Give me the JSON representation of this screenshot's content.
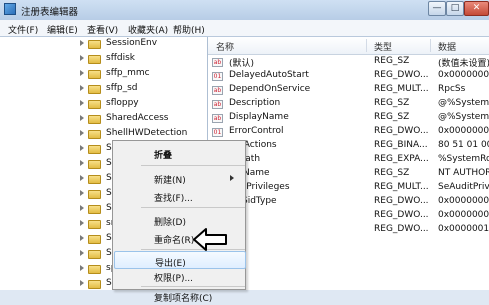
{
  "window": {
    "title": "注册表编辑器",
    "buttons": {
      "minimize": "—",
      "maximize": "□",
      "close": "✕"
    }
  },
  "menu": {
    "items": [
      "文件(F)",
      "编辑(E)",
      "查看(V)",
      "收藏夹(A)",
      "帮助(H)"
    ]
  },
  "tree": {
    "items": [
      {
        "label": "SessionEnv"
      },
      {
        "label": "sffdisk"
      },
      {
        "label": "sffp_mmc"
      },
      {
        "label": "sffp_sd"
      },
      {
        "label": "sfloppy"
      },
      {
        "label": "SharedAccess"
      },
      {
        "label": "ShellHWDetection"
      },
      {
        "label": "SiSRa"
      },
      {
        "label": "SiSRa"
      },
      {
        "label": "Smb"
      },
      {
        "label": "SMS"
      },
      {
        "label": "SMS"
      },
      {
        "label": "snap"
      },
      {
        "label": "SNM"
      },
      {
        "label": "Sogo"
      },
      {
        "label": "spldr"
      },
      {
        "label": "Spoo"
      }
    ]
  },
  "values": {
    "headers": {
      "name": "名称",
      "type": "类型",
      "data": "数据"
    },
    "rows": [
      {
        "name": "(默认)",
        "type": "REG_SZ",
        "data": "(数值未设置)"
      },
      {
        "name": "DelayedAutoStart",
        "type": "REG_DWO...",
        "data": "0x00000001"
      },
      {
        "name": "DependOnService",
        "type": "REG_MULT...",
        "data": "RpcSs"
      },
      {
        "name": "Description",
        "type": "REG_SZ",
        "data": "@%SystemR"
      },
      {
        "name": "DisplayName",
        "type": "REG_SZ",
        "data": "@%SystemR"
      },
      {
        "name": "ErrorControl",
        "type": "REG_DWO...",
        "data": "0x00000001"
      },
      {
        "name": "ureActions",
        "type": "REG_BINA...",
        "data": "80 51 01 00"
      },
      {
        "name": "gePath",
        "type": "REG_EXPA...",
        "data": "%SystemRoo"
      },
      {
        "name": "ectName",
        "type": "REG_SZ",
        "data": "NT AUTHOR"
      },
      {
        "name": "iredPrivileges",
        "type": "REG_MULT...",
        "data": "SeAuditPrivil"
      },
      {
        "name": "iceSidType",
        "type": "REG_DWO...",
        "data": "0x00000001"
      },
      {
        "name": "",
        "type": "REG_DWO...",
        "data": "0x00000002"
      },
      {
        "name": "",
        "type": "REG_DWO...",
        "data": "0x00000010"
      }
    ]
  },
  "context_menu": {
    "items": [
      {
        "label": "折叠",
        "bold": true,
        "submenu": false
      },
      {
        "label": "新建(N)",
        "bold": false,
        "submenu": true
      },
      {
        "label": "查找(F)...",
        "bold": false,
        "submenu": false
      },
      {
        "label": "删除(D)",
        "bold": false,
        "submenu": false
      },
      {
        "label": "重命名(R)",
        "bold": false,
        "submenu": false
      },
      {
        "label": "导出(E)",
        "bold": false,
        "submenu": false,
        "highlighted": true
      },
      {
        "label": "权限(P)...",
        "bold": false,
        "submenu": false
      },
      {
        "label": "复制项名称(C)",
        "bold": false,
        "submenu": false
      }
    ]
  }
}
